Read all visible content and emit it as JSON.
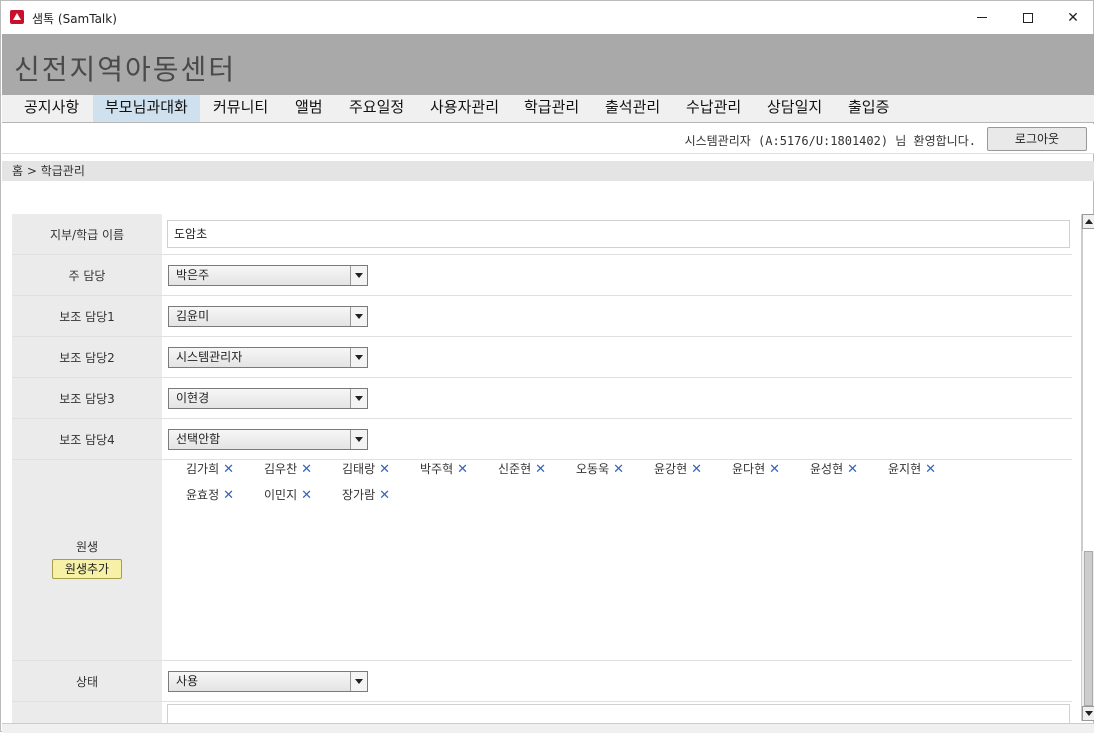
{
  "window": {
    "title": "샘톡 (SamTalk)",
    "icon": "app-logo-icon"
  },
  "header": {
    "site_title": "신전지역아동센터"
  },
  "nav": {
    "items": [
      {
        "label": "공지사항"
      },
      {
        "label": "부모님과대화",
        "active": true
      },
      {
        "label": "커뮤니티"
      },
      {
        "label": "앨범"
      },
      {
        "label": "주요일정"
      },
      {
        "label": "사용자관리"
      },
      {
        "label": "학급관리"
      },
      {
        "label": "출석관리"
      },
      {
        "label": "수납관리"
      },
      {
        "label": "상담일지"
      },
      {
        "label": "출입증"
      }
    ]
  },
  "userbar": {
    "welcome": "시스템관리자 (A:5176/U:1801402) 님 환영합니다.",
    "logout_label": "로그아웃"
  },
  "breadcrumb": "홈 > 학급관리",
  "form": {
    "class_name_label": "지부/학급 이름",
    "class_name_value": "도암초",
    "main_teacher_label": "주 담당",
    "main_teacher_value": "박은주",
    "assistant1_label": "보조 담당1",
    "assistant1_value": "김윤미",
    "assistant2_label": "보조 담당2",
    "assistant2_value": "시스템관리자",
    "assistant3_label": "보조 담당3",
    "assistant3_value": "이현경",
    "assistant4_label": "보조 담당4",
    "assistant4_value": "선택안함",
    "students_label": "원생",
    "add_student_label": "원생추가",
    "students": [
      "김가희",
      "김우찬",
      "김태랑",
      "박주혁",
      "신준현",
      "오동욱",
      "윤강현",
      "윤다현",
      "윤성현",
      "윤지현",
      "윤효정",
      "이민지",
      "장가람"
    ],
    "status_label": "상태",
    "status_value": "사용"
  },
  "colors": {
    "header_bg": "#a9a9a9",
    "nav_active": "#cfe0ee",
    "add_button": "#f6f1a7",
    "chip_remove": "#3a63b5"
  }
}
